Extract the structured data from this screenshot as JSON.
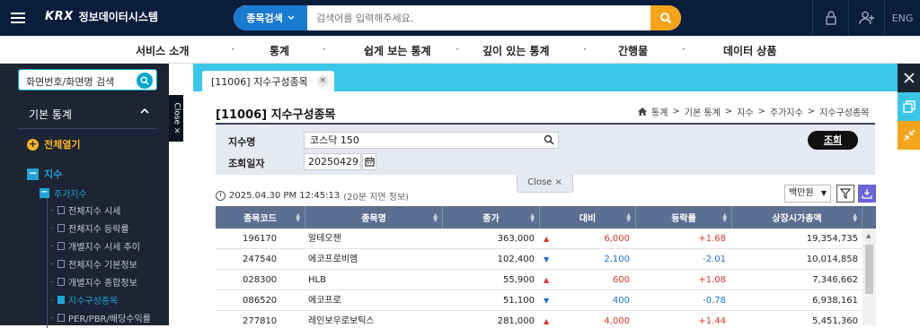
{
  "header": {
    "logo_brand": "KRX",
    "logo_name": "정보데이터시스템",
    "search_category": "종목검색",
    "search_placeholder": "검색어를 입력해주세요.",
    "lang": "ENG"
  },
  "gnb": {
    "items": [
      "서비스 소개",
      "통계",
      "쉽게 보는 통계",
      "깊이 있는 통계",
      "간행물",
      "데이터 상품"
    ],
    "separator": "·"
  },
  "sidebar": {
    "search_placeholder": "화면번호/화면명 검색",
    "section_title": "기본 통계",
    "expand_all": "전체열기",
    "tree_root": "지수",
    "tree_group": "주가지수",
    "leaves": [
      "전체지수 시세",
      "전체지수 등락률",
      "개별지수 시세 추이",
      "전체지수 기본정보",
      "개별지수 종합정보",
      "지수구성종목",
      "PER/PBR/배당수익률"
    ],
    "close_label": "Close ×"
  },
  "tabs": {
    "active_label": "[11006] 지수구성종목",
    "close": "×"
  },
  "page": {
    "title": "[11006] 지수구성종목",
    "breadcrumb": [
      "통계",
      "기본 통계",
      "지수",
      "주가지수",
      "지수구성종목"
    ],
    "breadcrumb_sep": ">"
  },
  "filter": {
    "index_label": "지수명",
    "index_value": "코스닥 150",
    "date_label": "조회일자",
    "date_value": "20250429",
    "submit_label": "조회",
    "close_label": "Close ×"
  },
  "info": {
    "timestamp": "2025.04.30 PM 12:45:13",
    "delay": "(20분 지연 정보)",
    "unit": "백만원"
  },
  "grid": {
    "columns": [
      "종목코드",
      "종목명",
      "종가",
      "대비",
      "등락률",
      "상장시가총액"
    ],
    "rows": [
      {
        "code": "196170",
        "name": "알테오젠",
        "close": "363,000",
        "dir": "▲",
        "change": "6,000",
        "rate": "+1.68",
        "cap": "19,354,735",
        "trend": "up"
      },
      {
        "code": "247540",
        "name": "에코프로비엠",
        "close": "102,400",
        "dir": "▼",
        "change": "2,100",
        "rate": "-2.01",
        "cap": "10,014,858",
        "trend": "down"
      },
      {
        "code": "028300",
        "name": "HLB",
        "close": "55,900",
        "dir": "▲",
        "change": "600",
        "rate": "+1.08",
        "cap": "7,346,662",
        "trend": "up"
      },
      {
        "code": "086520",
        "name": "에코프로",
        "close": "51,100",
        "dir": "▼",
        "change": "400",
        "rate": "-0.78",
        "cap": "6,938,161",
        "trend": "down"
      },
      {
        "code": "277810",
        "name": "레인보우로보틱스",
        "close": "281,000",
        "dir": "▲",
        "change": "4,000",
        "rate": "+1.44",
        "cap": "5,451,360",
        "trend": "up"
      }
    ]
  },
  "colors": {
    "topbar": "#0a1d3d",
    "accent": "#3cc6e6",
    "up": "#d9352c",
    "down": "#1f6fd0"
  }
}
